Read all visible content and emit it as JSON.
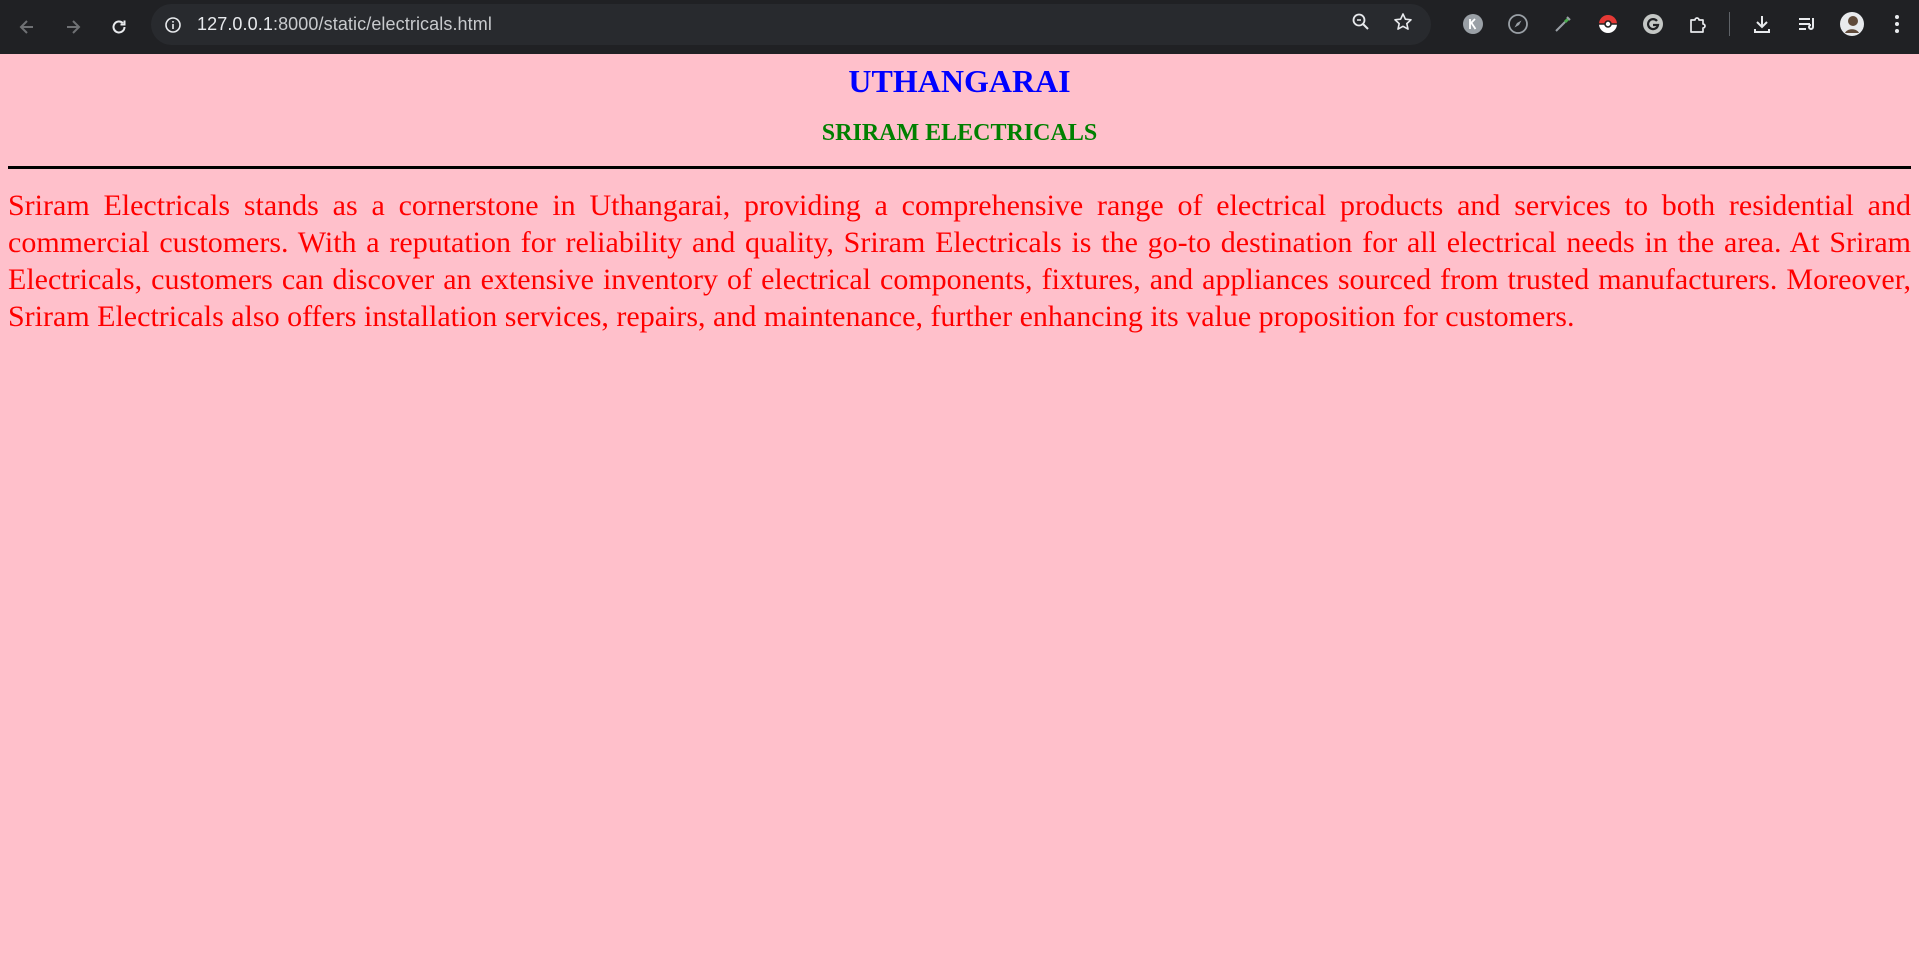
{
  "browser": {
    "url_host": "127.0.0.1",
    "url_path": ":8000/static/electricals.html"
  },
  "page": {
    "title": "UTHANGARAI",
    "subtitle": "SRIRAM ELECTRICALS",
    "paragraph": "Sriram Electricals stands as a cornerstone in Uthangarai, providing a comprehensive range of electrical products and services to both residential and commercial customers. With a reputation for reliability and quality, Sriram Electricals is the go-to destination for all electrical needs in the area. At Sriram Electricals, customers can discover an extensive inventory of electrical components, fixtures, and appliances sourced from trusted manufacturers. Moreover, Sriram Electricals also offers installation services, repairs, and maintenance, further enhancing its value proposition for customers."
  },
  "colors": {
    "page_background": "#ffc0cb",
    "title": "#0000ff",
    "subtitle": "#008000",
    "paragraph": "#ff0000",
    "toolbar": "#202124"
  },
  "icons": [
    "back-arrow-icon",
    "forward-arrow-icon",
    "reload-icon",
    "site-info-icon",
    "zoom-icon",
    "bookmark-star-icon",
    "extension-k-icon",
    "compass-extension-icon",
    "eyedropper-extension-icon",
    "pokeball-extension-icon",
    "grammarly-extension-icon",
    "extensions-puzzle-icon",
    "download-icon",
    "reading-list-icon",
    "profile-avatar",
    "more-menu-icon"
  ]
}
